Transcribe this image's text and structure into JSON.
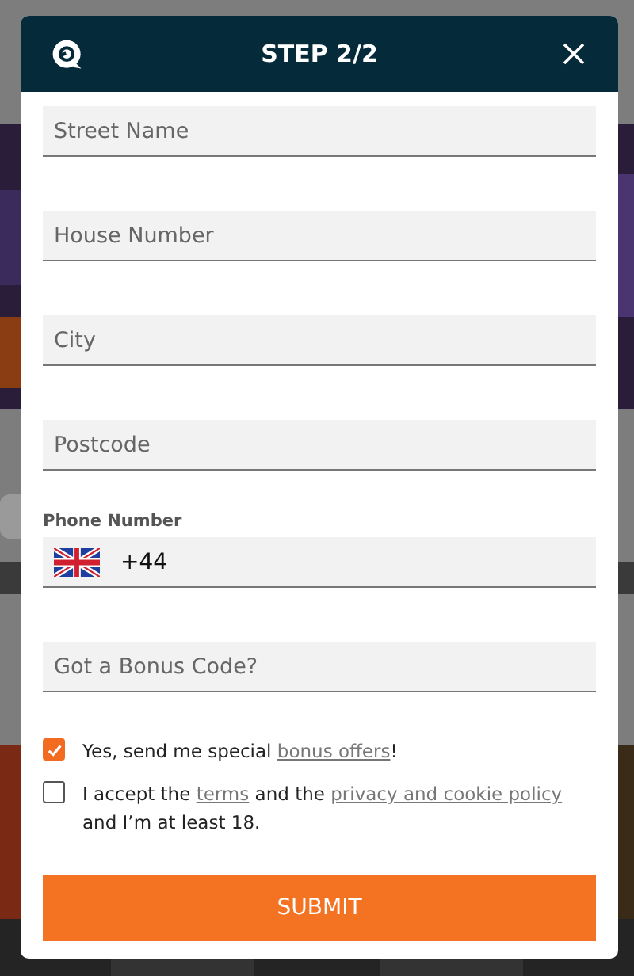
{
  "dialog": {
    "title": "STEP 2/2"
  },
  "fields": [
    {
      "kind": "text",
      "placeholder": "Street Name"
    },
    {
      "kind": "text",
      "placeholder": "House Number"
    },
    {
      "kind": "text",
      "placeholder": "City"
    },
    {
      "kind": "text",
      "placeholder": "Postcode"
    },
    {
      "kind": "phone",
      "label": "Phone Number",
      "value": "+44"
    },
    {
      "kind": "text",
      "placeholder": "Got a Bonus Code?"
    }
  ],
  "consents": [
    {
      "checked": true,
      "parts": [
        {
          "kind": "text",
          "text": "Yes, send me special "
        },
        {
          "kind": "link",
          "text": "bonus offers"
        },
        {
          "kind": "text",
          "text": "!"
        }
      ]
    },
    {
      "checked": false,
      "parts": [
        {
          "kind": "text",
          "text": "I accept the "
        },
        {
          "kind": "link",
          "text": "terms"
        },
        {
          "kind": "text",
          "text": " and the "
        },
        {
          "kind": "link",
          "text": "privacy and cookie policy"
        },
        {
          "kind": "text",
          "text": " and I’m at least 18."
        }
      ]
    }
  ],
  "submit": "SUBMIT"
}
